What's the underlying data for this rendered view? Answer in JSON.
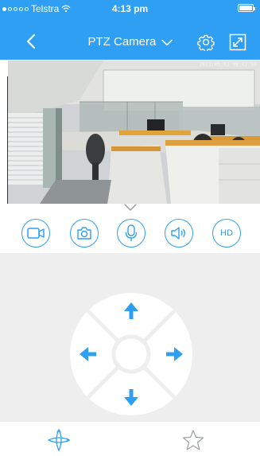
{
  "status_bar": {
    "carrier": "Telstra",
    "time": "4:13 pm",
    "signal_icon": "signal-dots-icon",
    "wifi_icon": "wifi-icon",
    "battery_icon": "battery-icon",
    "battery_level": 1.0
  },
  "nav": {
    "title": "PTZ Camera",
    "back_icon": "chevron-left-icon",
    "dropdown_icon": "chevron-down-icon",
    "settings_icon": "gear-icon",
    "fullscreen_icon": "expand-icon"
  },
  "video": {
    "timestamp": "2013/09/02 08:02:50"
  },
  "tools": [
    {
      "name": "record-button",
      "icon": "video-camera-icon"
    },
    {
      "name": "snapshot-button",
      "icon": "camera-icon"
    },
    {
      "name": "microphone-button",
      "icon": "microphone-icon"
    },
    {
      "name": "speaker-button",
      "icon": "speaker-icon"
    },
    {
      "name": "hd-button",
      "label": "HD"
    }
  ],
  "hd_label": "HD",
  "joystick": {
    "directions": [
      "up",
      "down",
      "left",
      "right"
    ],
    "arrow_icon": "arrow-icon"
  },
  "tabs": [
    {
      "name": "tab-ptz",
      "icon": "ptz-rotate-icon",
      "active": true
    },
    {
      "name": "tab-favorites",
      "icon": "star-icon",
      "active": false
    }
  ],
  "colors": {
    "accent": "#2f9ff3",
    "panel_bg": "#eeeeee",
    "joystick_bg": "#ffffff"
  }
}
